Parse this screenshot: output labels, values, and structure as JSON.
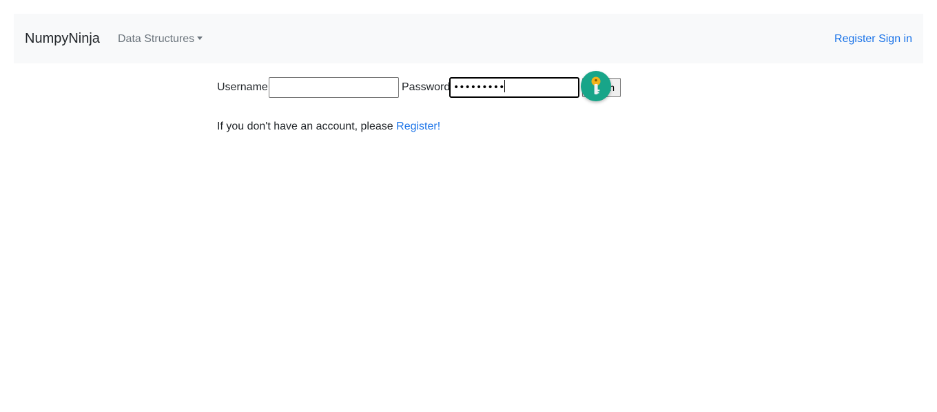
{
  "navbar": {
    "brand": "NumpyNinja",
    "dropdown_label": "Data Structures",
    "register_link": "Register",
    "signin_link": "Sign in"
  },
  "login_form": {
    "username_label": "Username:",
    "username_value": "",
    "password_label": "Password:",
    "password_value": "•••••••••",
    "submit_label": "Login",
    "submit_visible_text": "n"
  },
  "register_prompt": {
    "text": "If you don't have an account, please",
    "link": "Register!"
  },
  "icons": {
    "password_manager": "key-icon"
  },
  "colors": {
    "navbar_bg": "#f8f9fa",
    "link": "#1a73e8",
    "badge_bg": "#18a589",
    "key": "#f2b31b"
  }
}
